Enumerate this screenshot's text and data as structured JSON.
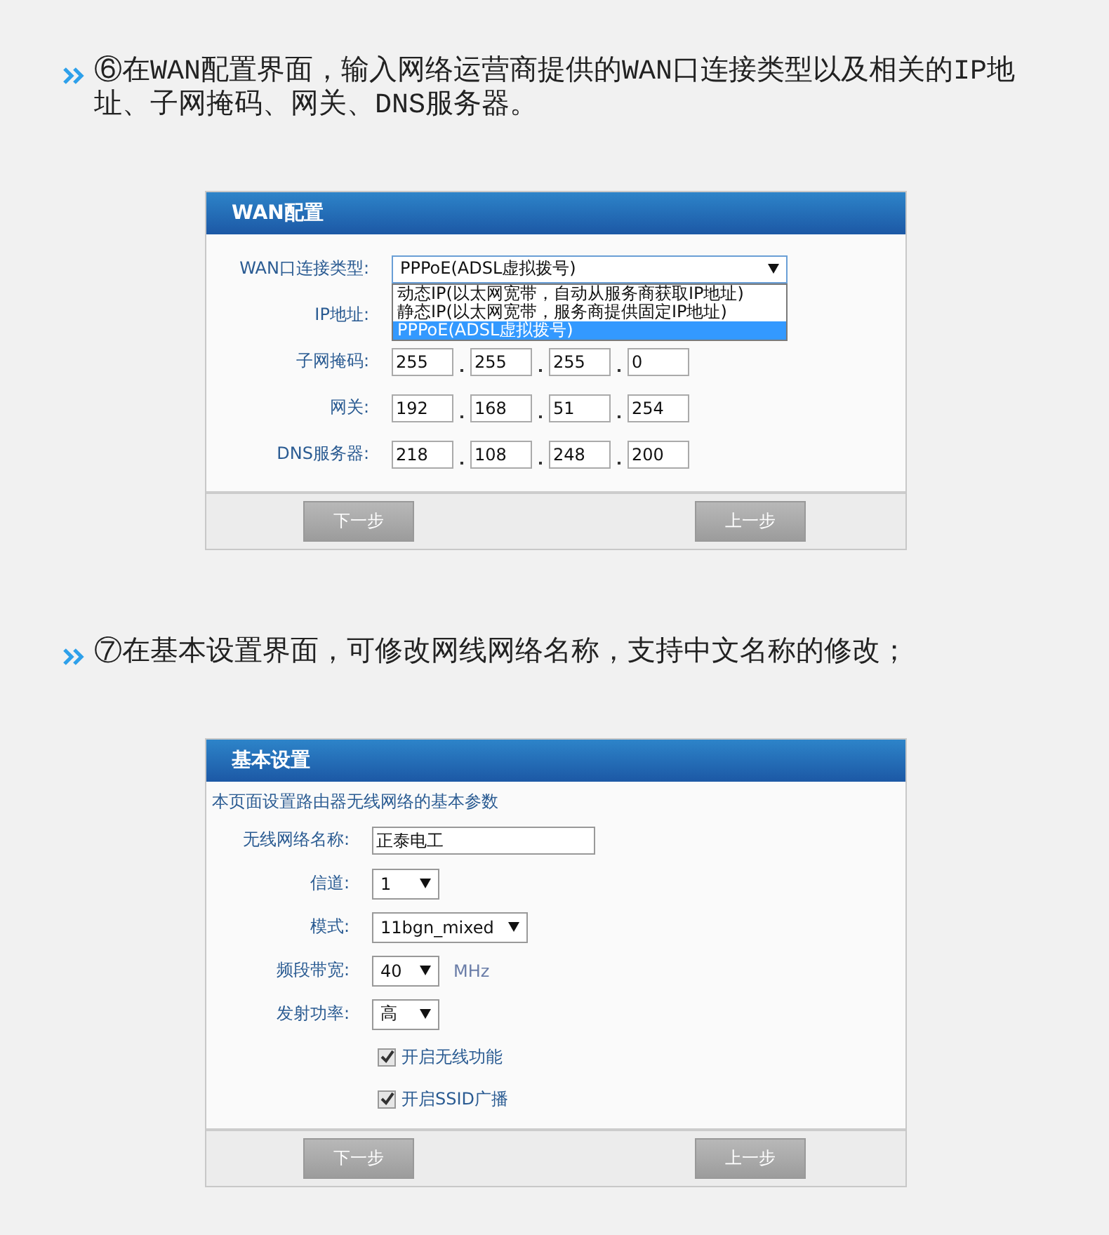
{
  "sections": [
    {
      "instruction": "⑥在WAN配置界面，输入网络运营商提供的WAN口连接类型以及相关的IP地址、子网掩码、网关、DNS服务器。",
      "panel": {
        "kind": "wan",
        "title": "WAN配置",
        "connection_type": {
          "label": "WAN口连接类型:",
          "value": "PPPoE(ADSL虚拟拨号)",
          "expanded": true,
          "options": [
            {
              "label": "动态IP(以太网宽带，自动从服务商获取IP地址)",
              "selected": false
            },
            {
              "label": "静态IP(以太网宽带，服务商提供固定IP地址)",
              "selected": false
            },
            {
              "label": "PPPoE(ADSL虚拟拨号)",
              "selected": true
            }
          ]
        },
        "ip_rows": [
          {
            "label": "IP地址:"
          },
          {
            "label": "子网掩码:",
            "octets": [
              "255",
              "255",
              "255",
              "0"
            ]
          },
          {
            "label": "网关:",
            "octets": [
              "192",
              "168",
              "51",
              "254"
            ]
          },
          {
            "label": "DNS服务器:",
            "octets": [
              "218",
              "108",
              "248",
              "200"
            ]
          }
        ],
        "buttons": [
          "下一步",
          "上一步"
        ]
      }
    },
    {
      "instruction": "⑦在基本设置界面，可修改网线网络名称，支持中文名称的修改；",
      "panel": {
        "kind": "basic",
        "title": "基本设置",
        "description": "本页面设置路由器无线网络的基本参数",
        "fields": [
          {
            "kind": "text",
            "label": "无线网络名称:",
            "value": "正泰电工"
          },
          {
            "kind": "select",
            "label": "信道:",
            "value": "1"
          },
          {
            "kind": "select",
            "label": "模式:",
            "value": "11bgn_mixed"
          },
          {
            "kind": "select",
            "label": "频段带宽:",
            "value": "40",
            "unit": "MHz"
          },
          {
            "kind": "select",
            "label": "发射功率:",
            "value": "高"
          }
        ],
        "checkboxes": [
          {
            "label": "开启无线功能",
            "checked": true
          },
          {
            "label": "开启SSID广播",
            "checked": true
          }
        ],
        "buttons": [
          "下一步",
          "上一步"
        ]
      }
    }
  ]
}
